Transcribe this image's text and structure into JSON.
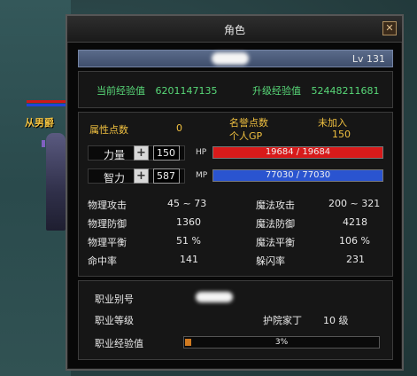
{
  "scene": {
    "character_name": "从男爵"
  },
  "window": {
    "title": "角色",
    "close_symbol": "✕"
  },
  "header": {
    "level": "Lv 131"
  },
  "experience": {
    "current_label": "当前经验值",
    "current_value": "6201147135",
    "next_label": "升级经验值",
    "next_value": "52448211681"
  },
  "attributes": {
    "points_label": "属性点数",
    "points_value": "0",
    "honor_label": "名誉点数",
    "honor_status": "未加入",
    "personal_gp_label": "个人GP",
    "personal_gp_value": "150",
    "strength_label": "力量",
    "strength_value": "150",
    "hp_label": "HP",
    "hp_text": "19684 / 19684",
    "hp_fraction": 1.0,
    "intelligence_label": "智力",
    "intelligence_value": "587",
    "mp_label": "MP",
    "mp_text": "77030 / 77030",
    "mp_fraction": 1.0,
    "plus_symbol": "+"
  },
  "combat": {
    "phys_attack_label": "物理攻击",
    "phys_attack_value": "45 ~ 73",
    "magic_attack_label": "魔法攻击",
    "magic_attack_value": "200 ~ 321",
    "phys_def_label": "物理防御",
    "phys_def_value": "1360",
    "magic_def_label": "魔法防御",
    "magic_def_value": "4218",
    "phys_balance_label": "物理平衡",
    "phys_balance_value": "51 %",
    "magic_balance_label": "魔法平衡",
    "magic_balance_value": "106 %",
    "hit_label": "命中率",
    "hit_value": "141",
    "dodge_label": "躲闪率",
    "dodge_value": "231"
  },
  "job": {
    "alias_label": "职业别号",
    "level_label": "职业等级",
    "level_title": "护院家丁",
    "level_value": "10 级",
    "exp_label": "职业经验值",
    "exp_text": "3%",
    "exp_fraction": 0.03
  },
  "colors": {
    "hp_fill": "#d81a1a",
    "mp_fill": "#2a54d0",
    "exp_green": "#58d878",
    "gold_label": "#f0c040",
    "job_exp_fill": "#d07a20"
  }
}
